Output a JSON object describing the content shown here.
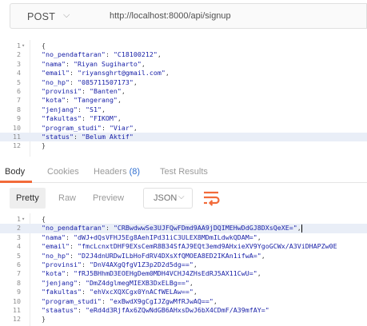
{
  "request": {
    "method": "POST",
    "url": "http://localhost:8000/api/signup"
  },
  "request_body": {
    "lines": [
      {
        "n": "1",
        "fold": "▾",
        "parts": [
          [
            "brace",
            "{"
          ]
        ]
      },
      {
        "n": "2",
        "parts": [
          [
            "key",
            "\"no_pendaftaran\""
          ],
          [
            "brace",
            ": "
          ],
          [
            "val",
            "\"C18100212\""
          ],
          [
            "brace",
            ","
          ]
        ]
      },
      {
        "n": "3",
        "parts": [
          [
            "key",
            "\"nama\""
          ],
          [
            "brace",
            ": "
          ],
          [
            "val",
            "\"Riyan Sugiharto\""
          ],
          [
            "brace",
            ","
          ]
        ]
      },
      {
        "n": "4",
        "parts": [
          [
            "key",
            "\"email\""
          ],
          [
            "brace",
            ": "
          ],
          [
            "val",
            "\"riyansghrt@gmail.com\""
          ],
          [
            "brace",
            ","
          ]
        ]
      },
      {
        "n": "5",
        "parts": [
          [
            "key",
            "\"no_hp\""
          ],
          [
            "brace",
            ": "
          ],
          [
            "val",
            "\"085711507173\""
          ],
          [
            "brace",
            ","
          ]
        ]
      },
      {
        "n": "6",
        "parts": [
          [
            "key",
            "\"provinsi\""
          ],
          [
            "brace",
            ": "
          ],
          [
            "val",
            "\"Banten\""
          ],
          [
            "brace",
            ","
          ]
        ]
      },
      {
        "n": "7",
        "parts": [
          [
            "key",
            "\"kota\""
          ],
          [
            "brace",
            ": "
          ],
          [
            "val",
            "\"Tangerang\""
          ],
          [
            "brace",
            ","
          ]
        ]
      },
      {
        "n": "8",
        "parts": [
          [
            "key",
            "\"jenjang\""
          ],
          [
            "brace",
            ": "
          ],
          [
            "val",
            "\"S1\""
          ],
          [
            "brace",
            ","
          ]
        ]
      },
      {
        "n": "9",
        "parts": [
          [
            "key",
            "\"fakultas\""
          ],
          [
            "brace",
            ": "
          ],
          [
            "val",
            "\"FIKOM\""
          ],
          [
            "brace",
            ","
          ]
        ]
      },
      {
        "n": "10",
        "parts": [
          [
            "key",
            "\"program_studi\""
          ],
          [
            "brace",
            ": "
          ],
          [
            "val",
            "\"Viar\""
          ],
          [
            "brace",
            ","
          ]
        ]
      },
      {
        "n": "11",
        "active": true,
        "parts": [
          [
            "key",
            "\"status\""
          ],
          [
            "brace",
            ": "
          ],
          [
            "val",
            "\"Belum Aktif\""
          ]
        ]
      },
      {
        "n": "12",
        "parts": [
          [
            "brace",
            "}"
          ]
        ]
      }
    ]
  },
  "response_tabs": [
    {
      "label": "Body",
      "active": true
    },
    {
      "label": "Cookies"
    },
    {
      "label": "Headers",
      "count": "(8)"
    },
    {
      "label": "Test Results"
    }
  ],
  "view_modes": [
    {
      "label": "Pretty",
      "active": true
    },
    {
      "label": "Raw"
    },
    {
      "label": "Preview"
    }
  ],
  "format": "JSON",
  "icons": {
    "method_dropdown": "chevron-down-icon",
    "format_dropdown": "chevron-down-icon",
    "wrap": "wrap-lines-icon"
  },
  "colors": {
    "accent": "#f26b3a",
    "json_key": "#1a22a8",
    "active_line": "#e9eef7"
  },
  "response_body": {
    "lines": [
      {
        "n": "1",
        "fold": "▾",
        "parts": [
          [
            "brace",
            "{"
          ]
        ]
      },
      {
        "n": "2",
        "active": true,
        "caret": true,
        "parts": [
          [
            "key",
            "\"no_pendaftaran\""
          ],
          [
            "brace",
            ": "
          ],
          [
            "val",
            "\"CRBwdwwSe3UJFQwFDmd9AA9jDQIMEHwDdGJ8DXsQeXE=\""
          ],
          [
            "brace",
            ","
          ]
        ]
      },
      {
        "n": "3",
        "parts": [
          [
            "key",
            "\"nama\""
          ],
          [
            "brace",
            ": "
          ],
          [
            "val",
            "\"dWJ+dQsVFHJ5Eg8AehIPd31iC3ULEX8MDmILdwkQDAM=\""
          ],
          [
            "brace",
            ","
          ]
        ]
      },
      {
        "n": "4",
        "parts": [
          [
            "key",
            "\"email\""
          ],
          [
            "brace",
            ": "
          ],
          [
            "val",
            "\"fmcLcnxtDHF9EXsCemR8B34SfAJ9EQt3emd9AHxieXV9YgoGCWx/A3ViDHAPZw0E"
          ]
        ]
      },
      {
        "n": "5",
        "parts": [
          [
            "key",
            "\"no_hp\""
          ],
          [
            "brace",
            ": "
          ],
          [
            "val",
            "\"D2J4dnURDwILbHoFdRV4DXsXfQMOEA8ED2IKAn1ifwA=\""
          ],
          [
            "brace",
            ","
          ]
        ]
      },
      {
        "n": "6",
        "parts": [
          [
            "key",
            "\"provinsi\""
          ],
          [
            "brace",
            ": "
          ],
          [
            "val",
            "\"DnV4AXgQfgV1Z3p2D2d5dg==\""
          ],
          [
            "brace",
            ","
          ]
        ]
      },
      {
        "n": "7",
        "parts": [
          [
            "key",
            "\"kota\""
          ],
          [
            "brace",
            ": "
          ],
          [
            "val",
            "\"fRJ5BHhmD3EOEHgDem0MDH4VCHJ4ZHsEdRJ5AX11CwU=\""
          ],
          [
            "brace",
            ","
          ]
        ]
      },
      {
        "n": "8",
        "parts": [
          [
            "key",
            "\"jenjang\""
          ],
          [
            "brace",
            ": "
          ],
          [
            "val",
            "\"DmZ4dglmegMIEXB3DxELBg==\""
          ],
          [
            "brace",
            ","
          ]
        ]
      },
      {
        "n": "9",
        "parts": [
          [
            "key",
            "\"fakultas\""
          ],
          [
            "brace",
            ": "
          ],
          [
            "val",
            "\"ehVxcXQXCgx0YnACfWELAw==\""
          ],
          [
            "brace",
            ","
          ]
        ]
      },
      {
        "n": "10",
        "parts": [
          [
            "key",
            "\"program_studi\""
          ],
          [
            "brace",
            ": "
          ],
          [
            "val",
            "\"exBwdX9gCgIJZgwMfRJwAQ==\""
          ],
          [
            "brace",
            ","
          ]
        ]
      },
      {
        "n": "11",
        "parts": [
          [
            "key",
            "\"staatus\""
          ],
          [
            "brace",
            ": "
          ],
          [
            "val",
            "\"eRd4d3RjfAx6ZQwNdGB6AHxsDwJ6bX4CDmF/A39mfAY=\""
          ]
        ]
      },
      {
        "n": "12",
        "parts": [
          [
            "brace",
            "}"
          ]
        ]
      }
    ]
  }
}
